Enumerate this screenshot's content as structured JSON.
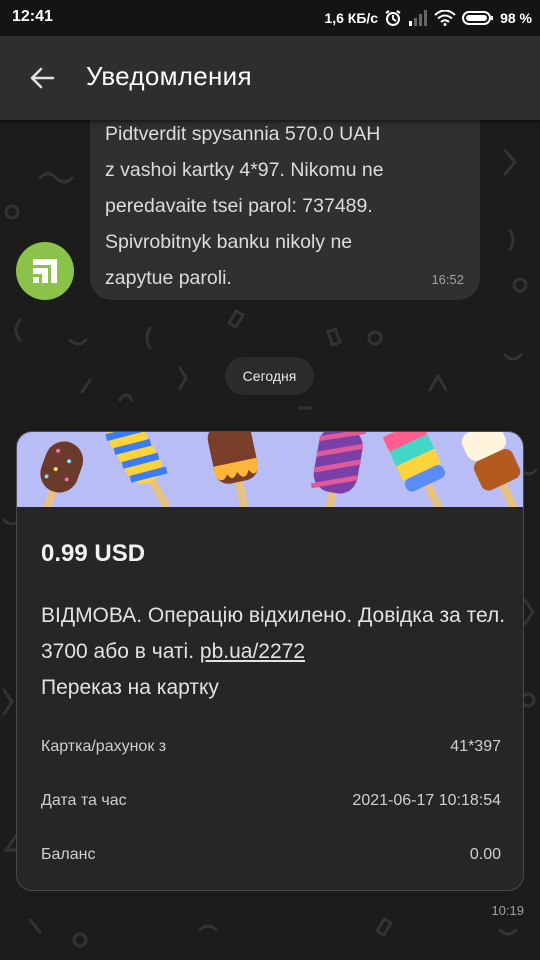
{
  "status_bar": {
    "time": "12:41",
    "net_speed": "1,6 КБ/с",
    "battery": "98 %",
    "icons": [
      "alarm-icon",
      "signal-icon",
      "wifi-icon",
      "battery-icon"
    ]
  },
  "app_bar": {
    "title": "Уведомления",
    "back_icon": "arrow-left-icon"
  },
  "messages": [
    {
      "lines": [
        "Pidtverdit spysannia 570.0 UAH",
        "z vashoi kartky 4*97. Nikomu ne",
        "peredavaite tsei parol: 737489.",
        "Spivrobitnyk banku nikoly ne",
        "zapytue paroli."
      ],
      "time": "16:52",
      "avatar_icon": "privatbank-logo-icon"
    }
  ],
  "date_separator": "Сегодня",
  "card": {
    "amount": "0.99 USD",
    "message_text": "ВІДМОВА. Операцію відхилено. Довідка за тел. 3700 або в чаті.",
    "link_text": "pb.ua/2272",
    "message_tail": "Переказ на картку",
    "details": [
      {
        "label": "Картка/рахунок з",
        "value": "41*397"
      },
      {
        "label": "Дата та час",
        "value": "2021-06-17 10:18:54"
      },
      {
        "label": "Баланс",
        "value": "0.00"
      }
    ],
    "time": "10:19",
    "banner_icon": "ice-cream-banner"
  },
  "colors": {
    "background": "#1c1c1c",
    "app_bar": "#2e2e2e",
    "bubble": "#303030",
    "card": "#262626",
    "avatar": "#8bc34a",
    "banner": "#b8bdf5"
  }
}
